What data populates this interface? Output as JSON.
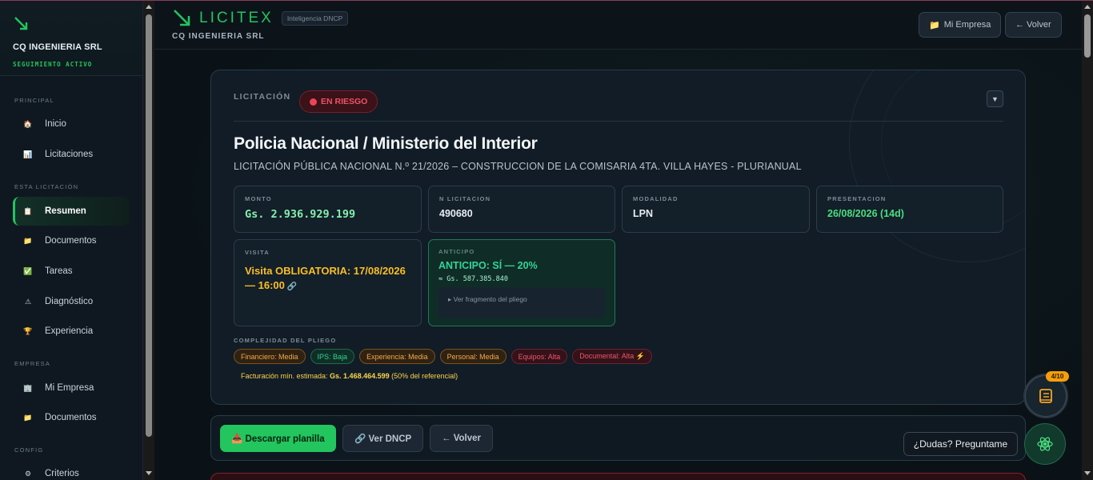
{
  "sidebar": {
    "company": "CQ INGENIERIA SRL",
    "status": "SEGUIMIENTO ACTIVO",
    "sections": [
      {
        "label": "PRINCIPAL"
      },
      {
        "label": "ESTA LICITACIÓN"
      },
      {
        "label": "EMPRESA"
      },
      {
        "label": "CONFIG"
      }
    ],
    "items": [
      {
        "label": "Inicio",
        "icon": "home-icon",
        "glyph": "🏠"
      },
      {
        "label": "Licitaciones",
        "icon": "chart-icon",
        "glyph": "📊"
      },
      {
        "label": "Resumen",
        "icon": "document-icon",
        "glyph": "📋"
      },
      {
        "label": "Documentos",
        "icon": "folder-icon",
        "glyph": "📁"
      },
      {
        "label": "Tareas",
        "icon": "checkbox-icon",
        "glyph": "✅"
      },
      {
        "label": "Diagnóstico",
        "icon": "warning-icon",
        "glyph": "⚠"
      },
      {
        "label": "Experiencia",
        "icon": "trophy-icon",
        "glyph": "🏆"
      },
      {
        "label": "Mi Empresa",
        "icon": "building-icon",
        "glyph": "🏢"
      },
      {
        "label": "Documentos",
        "icon": "folder-icon",
        "glyph": "📁"
      },
      {
        "label": "Criterios",
        "icon": "gear-icon",
        "glyph": "⚙"
      }
    ]
  },
  "header": {
    "brand": "LICITEX",
    "badge": "Inteligencia DNCP",
    "company": "CQ INGENIERIA SRL",
    "my_company_btn": "Mi Empresa",
    "back_btn": "← Volver"
  },
  "card": {
    "label": "LICITACIÓN",
    "risk": "EN RIESGO",
    "toggle": "▼",
    "title": "Policia Nacional / Ministerio del Interior",
    "subtitle": "LICITACIÓN PÚBLICA NACIONAL N.º 21/2026 – CONSTRUCCION DE LA COMISARIA 4TA. VILLA HAYES - PLURIANUAL",
    "monto": {
      "label": "MONTO",
      "value": "Gs. 2.936.929.199"
    },
    "nlic": {
      "label": "N LICITACION",
      "value": "490680"
    },
    "modalidad": {
      "label": "MODALIDAD",
      "value": "LPN"
    },
    "presentacion": {
      "label": "PRESENTACION",
      "value": "26/08/2026 (14d)"
    },
    "visita": {
      "label": "VISITA",
      "value": "Visita OBLIGATORIA: 17/08/2026 — 16:00",
      "link": "🔗"
    },
    "anticipo": {
      "label": "ANTICIPO",
      "value": "ANTICIPO: SÍ — 20%",
      "sub": "≈ Gs. 587.385.840",
      "fragment": "▸ Ver fragmento del pliego"
    },
    "complexity_label": "COMPLEJIDAD DEL PLIEGO",
    "tags": [
      {
        "label": "Financiero: Media",
        "level": "media"
      },
      {
        "label": "IPS: Baja",
        "level": "baja"
      },
      {
        "label": "Experiencia: Media",
        "level": "media"
      },
      {
        "label": "Personal: Media",
        "level": "media"
      },
      {
        "label": "Equipos: Alta",
        "level": "alta"
      },
      {
        "label": "Documental: Alta ⚡",
        "level": "alta"
      }
    ],
    "fact_prefix": "Facturación mín. estimada: ",
    "fact_value": "Gs. 1.468.464.599",
    "fact_suffix": " (50% del referencial)"
  },
  "actions": {
    "download": "📥 Descargar planilla",
    "dncp": "🔗 Ver DNCP",
    "back": "← Volver",
    "ask": "¿Dudas? Preguntame"
  },
  "fab": {
    "counter": "4/10"
  },
  "colors": {
    "accent": "#22c55e",
    "risk": "#ef4455",
    "warning": "#fbbf24"
  }
}
